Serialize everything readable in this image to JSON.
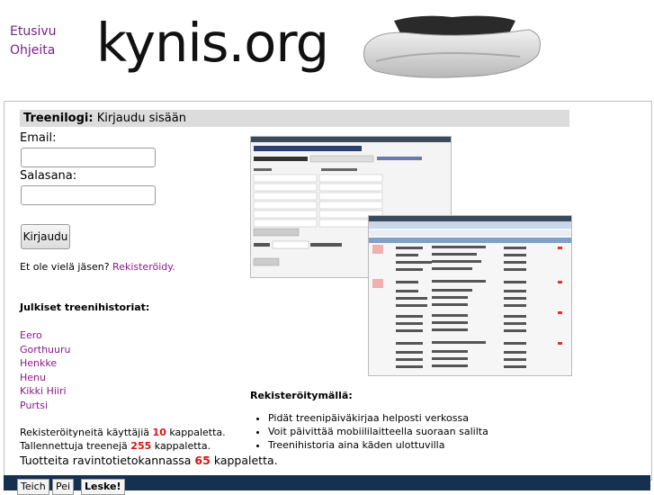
{
  "nav": {
    "home": "Etusivu",
    "help": "Ohjeita"
  },
  "logo_text": "kynis.org",
  "login": {
    "title_bold": "Treenilogi:",
    "title_rest": "Kirjaudu sisään",
    "email_label": "Email:",
    "password_label": "Salasana:",
    "button": "Kirjaudu",
    "not_member": "Et ole vielä jäsen?",
    "register_link": "Rekisteröidy."
  },
  "public": {
    "title": "Julkiset treenihistoriat:",
    "users": [
      "Eero",
      "Gorthuuru",
      "Henkke",
      "Henu",
      "Kikki Hiiri",
      "Purtsi"
    ]
  },
  "stats": {
    "users_pre": "Rekisteröityneitä käyttäjiä",
    "users_count": "10",
    "users_post": "kappaletta.",
    "workouts_pre": "Tallennettuja treenejä",
    "workouts_count": "255",
    "workouts_post": "kappaletta.",
    "products_pre": "Tuotteita ravintotietokannassa",
    "products_count": "65",
    "products_post": "kappaletta."
  },
  "registered": {
    "title": "Rekisteröitymällä:",
    "items": [
      "Pidät treenipäiväkirjaa helposti verkossa",
      "Voit päivittää mobiililaitteella suoraan salilta",
      "Treenihistoria aina käden ulottuvilla"
    ]
  },
  "footer": {
    "lang1": "Teich",
    "lang2": "Pei",
    "lang3": "Leske!"
  },
  "colors": {
    "link": "#7a1f8a",
    "accent_red": "#e01010",
    "footer": "#16304f",
    "titlebar": "#dcdcdc"
  }
}
